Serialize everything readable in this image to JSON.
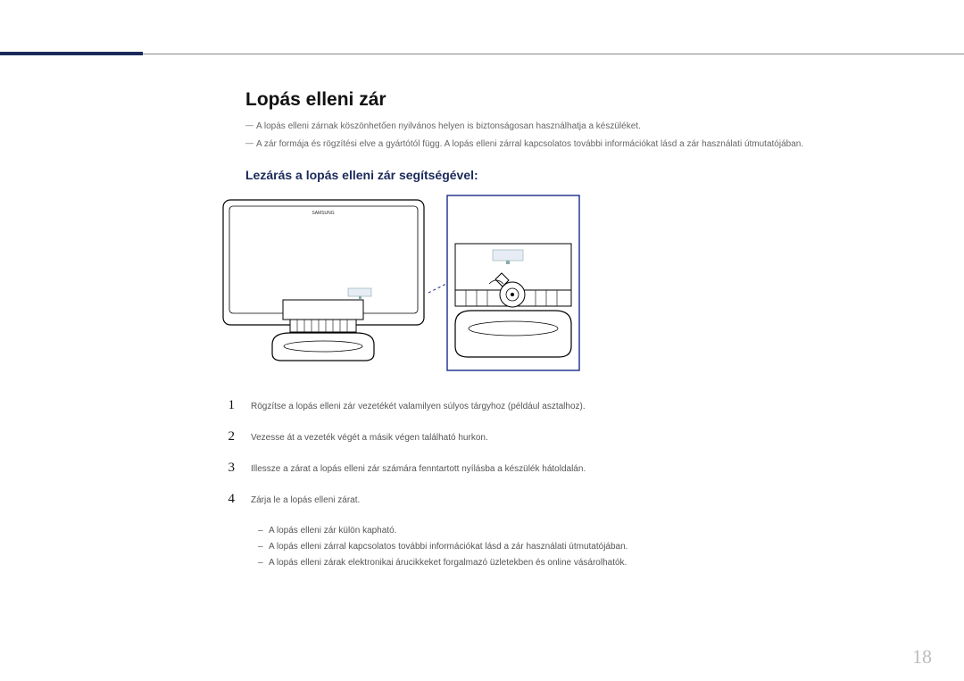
{
  "page_number": "18",
  "heading": "Lopás elleni zár",
  "intro_notes": [
    "A lopás elleni zárnak köszönhetően nyilvános helyen is biztonságosan használhatja a készüléket.",
    "A zár formája és rögzítési elve a gyártótól függ. A lopás elleni zárral kapcsolatos további információkat lásd a zár használati útmutatójában."
  ],
  "subheading": "Lezárás a lopás elleni zár segítségével:",
  "diagram": {
    "brand_label": "SAMSUNG",
    "port_label_main": "",
    "port_label_zoom": ""
  },
  "steps": [
    {
      "num": "1",
      "text": "Rögzítse a lopás elleni zár vezetékét valamilyen súlyos tárgyhoz (például asztalhoz)."
    },
    {
      "num": "2",
      "text": "Vezesse át a vezeték végét a másik végen található hurkon."
    },
    {
      "num": "3",
      "text": "Illessze a zárat a lopás elleni zár számára fenntartott nyílásba a készülék hátoldalán."
    },
    {
      "num": "4",
      "text": "Zárja le a lopás elleni zárat."
    }
  ],
  "sub_notes": [
    "A lopás elleni zár külön kapható.",
    "A lopás elleni zárral kapcsolatos további információkat lásd a zár használati útmutatójában.",
    "A lopás elleni zárak elektronikai árucikkeket forgalmazó üzletekben és online vásárolhatók."
  ]
}
